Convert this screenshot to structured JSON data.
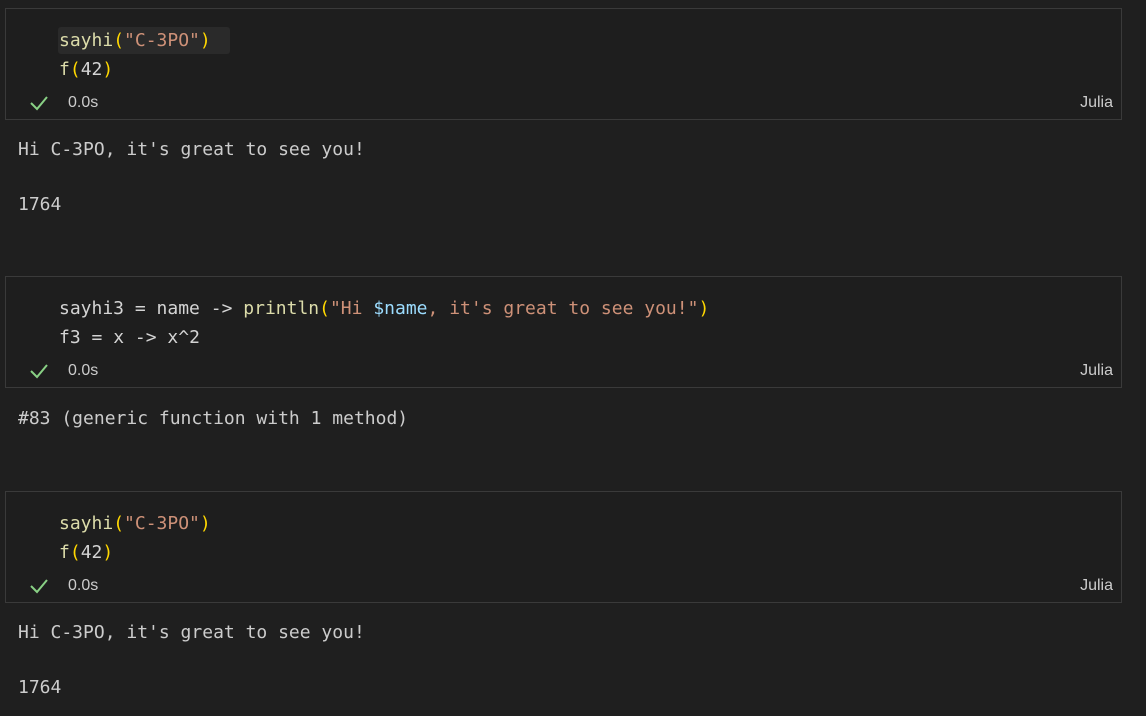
{
  "cells": [
    {
      "code": [
        [
          {
            "t": "sayhi",
            "c": "fn"
          },
          {
            "t": "(",
            "c": "paren"
          },
          {
            "t": "\"C-3PO\"",
            "c": "str"
          },
          {
            "t": ")",
            "c": "paren"
          }
        ],
        [
          {
            "t": "f",
            "c": "fn"
          },
          {
            "t": "(",
            "c": "paren"
          },
          {
            "t": "42",
            "c": "plain"
          },
          {
            "t": ")",
            "c": "paren"
          }
        ]
      ],
      "status": "0.0s",
      "language": "Julia",
      "outputs": [
        "Hi C-3PO, it's great to see you!",
        "1764"
      ]
    },
    {
      "code": [
        [
          {
            "t": "sayhi3",
            "c": "plain"
          },
          {
            "t": " = ",
            "c": "op"
          },
          {
            "t": "name",
            "c": "plain"
          },
          {
            "t": " -> ",
            "c": "op"
          },
          {
            "t": "println",
            "c": "fn"
          },
          {
            "t": "(",
            "c": "paren"
          },
          {
            "t": "\"Hi ",
            "c": "str"
          },
          {
            "t": "$name",
            "c": "var"
          },
          {
            "t": ", it's great to see you!\"",
            "c": "str"
          },
          {
            "t": ")",
            "c": "paren"
          }
        ],
        [
          {
            "t": "f3",
            "c": "plain"
          },
          {
            "t": " = ",
            "c": "op"
          },
          {
            "t": "x",
            "c": "plain"
          },
          {
            "t": " -> ",
            "c": "op"
          },
          {
            "t": "x^2",
            "c": "plain"
          }
        ]
      ],
      "status": "0.0s",
      "language": "Julia",
      "outputs": [
        "#83 (generic function with 1 method)"
      ]
    },
    {
      "code": [
        [
          {
            "t": "sayhi",
            "c": "fn"
          },
          {
            "t": "(",
            "c": "paren"
          },
          {
            "t": "\"C-3PO\"",
            "c": "str"
          },
          {
            "t": ")",
            "c": "paren"
          }
        ],
        [
          {
            "t": "f",
            "c": "fn"
          },
          {
            "t": "(",
            "c": "paren"
          },
          {
            "t": "42",
            "c": "plain"
          },
          {
            "t": ")",
            "c": "paren"
          }
        ]
      ],
      "status": "0.0s",
      "language": "Julia",
      "outputs": [
        "Hi C-3PO, it's great to see you!",
        "1764"
      ]
    }
  ],
  "colors": {
    "check": "#89d185",
    "background": "#1f1f1f",
    "cell_background": "#1e1e1e"
  },
  "icons": {
    "status": "check-icon"
  }
}
